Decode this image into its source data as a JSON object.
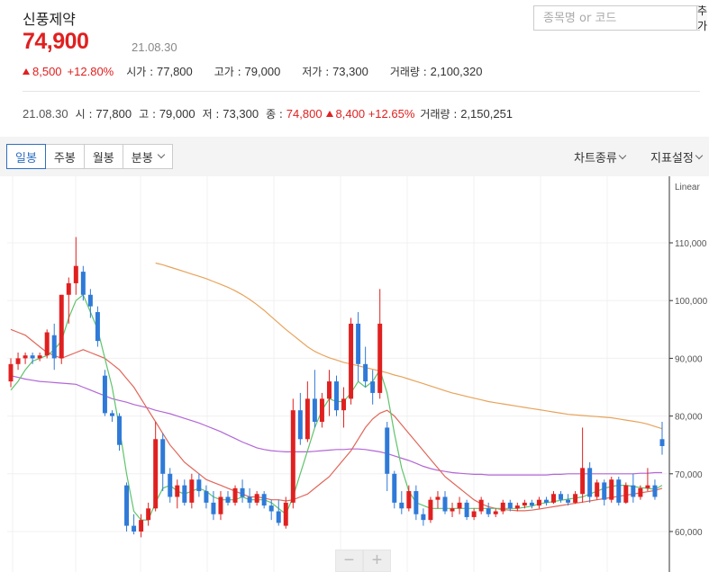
{
  "stock": {
    "name": "신풍제약",
    "price": "74,900",
    "date": "21.08.30",
    "change": "8,500",
    "change_pct": "+12.80%",
    "open_label": "시가 : ",
    "open": "77,800",
    "high_label": "고가 : ",
    "high": "79,000",
    "low_label": "저가 : ",
    "low": "73,300",
    "volume_label": "거래량 : ",
    "volume": "2,100,320"
  },
  "search": {
    "placeholder": "종목명 or 코드",
    "add_label": "추가"
  },
  "daily": {
    "date": "21.08.30",
    "open_label": "시 : ",
    "open": "77,800",
    "high_label": "고 : ",
    "high": "79,000",
    "low_label": "저 : ",
    "low": "73,300",
    "close_label": "종 : ",
    "close": "74,800",
    "change": "8,400",
    "change_pct": "+12.65%",
    "volume_label": "거래량 : ",
    "volume": "2,150,251"
  },
  "toolbar": {
    "tabs": [
      "일봉",
      "주봉",
      "월봉",
      "분봉"
    ],
    "active_tab": 0,
    "chart_type_label": "차트종류",
    "indicator_label": "지표설정"
  },
  "colors": {
    "up": "#e02020",
    "down": "#2f7ad8",
    "ma5": "#5fc46b",
    "ma20": "#e0665a",
    "ma60": "#b266d6",
    "ma120": "#e8a35a"
  },
  "chart_data": {
    "type": "candlestick",
    "scale": "Linear",
    "ylim": [
      57000,
      118000
    ],
    "y_ticks": [
      "60,000",
      "70,000",
      "80,000",
      "90,000",
      "100,000",
      "110,000"
    ],
    "y_tick_values": [
      60000,
      70000,
      80000,
      90000,
      100000,
      110000
    ],
    "ohlc": [
      [
        86000,
        90000,
        85000,
        89000
      ],
      [
        89000,
        91000,
        88000,
        90000
      ],
      [
        90000,
        91000,
        89000,
        90500
      ],
      [
        90500,
        91000,
        89000,
        90000
      ],
      [
        90000,
        91000,
        89500,
        90500
      ],
      [
        90500,
        95000,
        90000,
        94500
      ],
      [
        94000,
        96000,
        88000,
        90000
      ],
      [
        90000,
        101000,
        89000,
        101000
      ],
      [
        101000,
        104000,
        96000,
        103000
      ],
      [
        103000,
        111000,
        101000,
        106000
      ],
      [
        105000,
        106000,
        100000,
        101000
      ],
      [
        101000,
        102000,
        97000,
        99000
      ],
      [
        98000,
        99000,
        92000,
        93000
      ],
      [
        87000,
        88000,
        80000,
        80500
      ],
      [
        80500,
        81000,
        79000,
        80000
      ],
      [
        80000,
        80500,
        74000,
        75000
      ],
      [
        68000,
        68500,
        60000,
        61000
      ],
      [
        61000,
        63000,
        59500,
        60000
      ],
      [
        60000,
        63000,
        59000,
        62000
      ],
      [
        62000,
        65000,
        61000,
        64000
      ],
      [
        64000,
        79000,
        63500,
        76000
      ],
      [
        76000,
        77000,
        67000,
        70000
      ],
      [
        70000,
        71000,
        65000,
        66000
      ],
      [
        66000,
        69000,
        64000,
        68000
      ],
      [
        68000,
        69000,
        64500,
        65000
      ],
      [
        65000,
        70000,
        64000,
        69000
      ],
      [
        69000,
        70000,
        66000,
        67000
      ],
      [
        67000,
        68000,
        64000,
        65000
      ],
      [
        65000,
        67000,
        62000,
        63000
      ],
      [
        63000,
        67000,
        62000,
        66000
      ],
      [
        66000,
        67000,
        64500,
        65000
      ],
      [
        65000,
        68000,
        64500,
        67500
      ],
      [
        67500,
        69000,
        65000,
        66000
      ],
      [
        66000,
        67500,
        64000,
        65000
      ],
      [
        65000,
        67000,
        64500,
        66500
      ],
      [
        66500,
        67000,
        64000,
        64500
      ],
      [
        64500,
        65500,
        62000,
        63500
      ],
      [
        63500,
        65500,
        61000,
        61500
      ],
      [
        61000,
        66000,
        60500,
        65000
      ],
      [
        65000,
        83000,
        64000,
        81000
      ],
      [
        81000,
        84000,
        75000,
        76000
      ],
      [
        76000,
        86000,
        75500,
        83000
      ],
      [
        83000,
        88000,
        78000,
        79000
      ],
      [
        79000,
        84000,
        78000,
        83000
      ],
      [
        83000,
        88000,
        80000,
        86000
      ],
      [
        86000,
        87000,
        80000,
        81000
      ],
      [
        81000,
        85000,
        78000,
        83000
      ],
      [
        83000,
        97000,
        82000,
        96000
      ],
      [
        96000,
        98000,
        86000,
        89000
      ],
      [
        89000,
        92000,
        85000,
        86000
      ],
      [
        86000,
        88000,
        82000,
        84000
      ],
      [
        84000,
        102000,
        83000,
        96000
      ],
      [
        78000,
        79000,
        67000,
        70000
      ],
      [
        70000,
        70500,
        64000,
        65000
      ],
      [
        65000,
        67000,
        63000,
        64000
      ],
      [
        64000,
        68000,
        63500,
        67000
      ],
      [
        67000,
        68000,
        62000,
        63000
      ],
      [
        63000,
        64000,
        61000,
        62000
      ],
      [
        62000,
        66000,
        61500,
        65500
      ],
      [
        65500,
        67000,
        64000,
        66000
      ],
      [
        66000,
        67000,
        63000,
        63500
      ],
      [
        63500,
        65000,
        62500,
        64000
      ],
      [
        64000,
        66000,
        63000,
        65000
      ],
      [
        65000,
        65500,
        62000,
        62500
      ],
      [
        62500,
        64000,
        62000,
        63500
      ],
      [
        63500,
        66000,
        63000,
        65500
      ],
      [
        64000,
        65000,
        62500,
        63000
      ],
      [
        63000,
        64000,
        62500,
        63500
      ],
      [
        63500,
        65500,
        63000,
        65000
      ],
      [
        65000,
        65500,
        63500,
        64000
      ],
      [
        64000,
        65000,
        63500,
        64500
      ],
      [
        64500,
        65500,
        64000,
        65000
      ],
      [
        65000,
        65500,
        64000,
        64500
      ],
      [
        64500,
        66000,
        64000,
        65500
      ],
      [
        65500,
        66000,
        64500,
        65000
      ],
      [
        65000,
        67000,
        64800,
        66500
      ],
      [
        66500,
        67000,
        65000,
        65500
      ],
      [
        65500,
        66500,
        64500,
        65000
      ],
      [
        65000,
        67000,
        64800,
        66500
      ],
      [
        66500,
        78000,
        65000,
        71000
      ],
      [
        71000,
        72000,
        65000,
        66000
      ],
      [
        66000,
        69000,
        65500,
        68500
      ],
      [
        68500,
        69000,
        64500,
        65500
      ],
      [
        65500,
        69500,
        65000,
        69000
      ],
      [
        69000,
        69500,
        64500,
        65000
      ],
      [
        65000,
        68500,
        64800,
        68000
      ],
      [
        68000,
        70000,
        65000,
        66000
      ],
      [
        66000,
        68000,
        65500,
        67500
      ],
      [
        67500,
        71000,
        67000,
        68000
      ],
      [
        68000,
        69000,
        65500,
        66000
      ],
      [
        76000,
        79000,
        73300,
        74800
      ]
    ],
    "ma5": [
      84500,
      86000,
      88000,
      89500,
      90000,
      90500,
      91500,
      93000,
      97000,
      100000,
      101000,
      98000,
      95000,
      90000,
      85000,
      78000,
      70000,
      63500,
      62000,
      62000,
      65000,
      67500,
      68000,
      67000,
      66500,
      67000,
      67500,
      67000,
      66000,
      65500,
      65500,
      65500,
      66000,
      65500,
      65500,
      65500,
      65000,
      64000,
      63000,
      66000,
      70000,
      74000,
      78000,
      81000,
      83000,
      82500,
      82500,
      84000,
      86000,
      85000,
      86000,
      88000,
      84000,
      77000,
      71000,
      67000,
      65000,
      64500,
      64000,
      64000,
      64000,
      64000,
      64000,
      64000,
      64000,
      64000,
      64000,
      64000,
      64000,
      64000,
      64000,
      64200,
      64400,
      64800,
      65000,
      65200,
      65400,
      65600,
      65800,
      66000,
      66500,
      67000,
      67500,
      67800,
      68000,
      68000,
      67800,
      67600,
      67500,
      67300,
      68000
    ],
    "ma20": [
      95000,
      94500,
      94000,
      93000,
      92000,
      91000,
      90500,
      90000,
      90500,
      91000,
      91500,
      91000,
      90500,
      90000,
      89000,
      88000,
      86500,
      85000,
      83000,
      81000,
      79000,
      77000,
      75000,
      73500,
      72000,
      71000,
      70000,
      69000,
      68500,
      68000,
      67500,
      67000,
      66500,
      66000,
      66000,
      65800,
      65500,
      65500,
      65300,
      65500,
      66000,
      66500,
      67500,
      68500,
      69500,
      71000,
      72500,
      74000,
      76000,
      78000,
      79500,
      80500,
      81000,
      80000,
      78500,
      77000,
      75500,
      74000,
      72500,
      71000,
      69500,
      68500,
      67500,
      66500,
      65500,
      64800,
      64300,
      64000,
      63800,
      63700,
      63600,
      63600,
      63700,
      63900,
      64100,
      64300,
      64500,
      64700,
      64900,
      65100,
      65300,
      65500,
      65700,
      65900,
      66100,
      66300,
      66500,
      66700,
      66900,
      67100,
      67500
    ],
    "ma60": [
      87000,
      86700,
      86400,
      86200,
      86000,
      85900,
      85800,
      85700,
      85600,
      85500,
      85000,
      84500,
      84000,
      83500,
      83000,
      82700,
      82400,
      82000,
      81700,
      81400,
      81000,
      80700,
      80400,
      80000,
      79600,
      79200,
      78800,
      78300,
      77800,
      77300,
      76700,
      76100,
      75500,
      75000,
      74500,
      74200,
      74000,
      73900,
      73800,
      73800,
      73800,
      73800,
      73900,
      74000,
      74100,
      74200,
      74200,
      74300,
      74300,
      74200,
      74000,
      73800,
      73500,
      73100,
      72700,
      72300,
      71800,
      71300,
      70900,
      70600,
      70400,
      70200,
      70100,
      70000,
      69900,
      69900,
      69800,
      69800,
      69800,
      69800,
      69800,
      69800,
      69800,
      69800,
      69800,
      69900,
      69900,
      70000,
      70000,
      70000,
      70000,
      70000,
      70000,
      70000,
      70000,
      70000,
      70000,
      70100,
      70100,
      70200,
      70200
    ],
    "ma120": [
      null,
      null,
      null,
      null,
      null,
      null,
      null,
      null,
      null,
      null,
      null,
      null,
      null,
      null,
      null,
      null,
      null,
      null,
      null,
      null,
      106500,
      106200,
      105800,
      105400,
      105000,
      104600,
      104200,
      103800,
      103300,
      102800,
      102300,
      101700,
      101000,
      100200,
      99300,
      98300,
      97200,
      96100,
      95000,
      94000,
      93000,
      92000,
      91200,
      90600,
      90100,
      89700,
      89300,
      89000,
      88700,
      88400,
      88100,
      87800,
      87500,
      87100,
      86800,
      86400,
      86000,
      85600,
      85200,
      84800,
      84400,
      84000,
      83700,
      83400,
      83100,
      82800,
      82500,
      82300,
      82100,
      81900,
      81700,
      81500,
      81300,
      81100,
      80900,
      80700,
      80500,
      80300,
      80200,
      80100,
      80000,
      79900,
      79800,
      79700,
      79500,
      79300,
      79100,
      78900,
      78600,
      78200,
      77800
    ]
  }
}
